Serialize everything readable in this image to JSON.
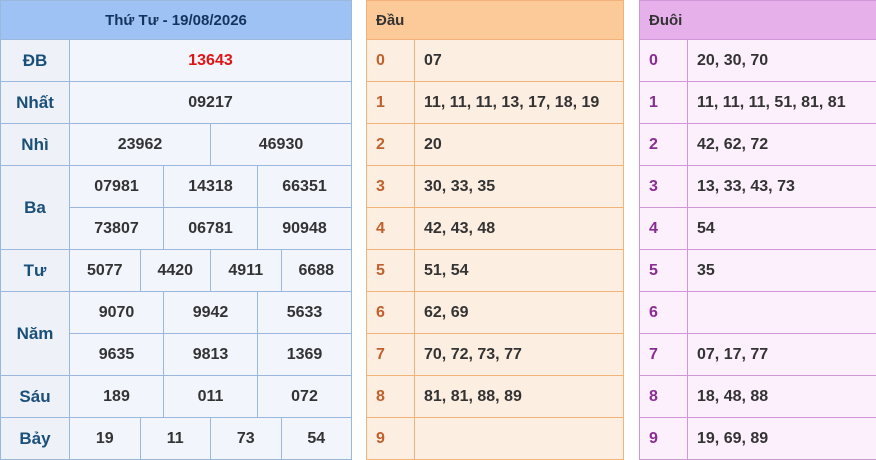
{
  "results": {
    "title": "Thứ Tư - 19/08/2026",
    "db": {
      "label": "ĐB",
      "value": "13643"
    },
    "nhat": {
      "label": "Nhất",
      "value": "09217"
    },
    "nhi": {
      "label": "Nhì",
      "values": [
        "23962",
        "46930"
      ]
    },
    "ba": {
      "label": "Ba",
      "values": [
        "07981",
        "14318",
        "66351",
        "73807",
        "06781",
        "90948"
      ]
    },
    "tu": {
      "label": "Tư",
      "values": [
        "5077",
        "4420",
        "4911",
        "6688"
      ]
    },
    "nam": {
      "label": "Năm",
      "values": [
        "9070",
        "9942",
        "5633",
        "9635",
        "9813",
        "1369"
      ]
    },
    "sau": {
      "label": "Sáu",
      "values": [
        "189",
        "011",
        "072"
      ]
    },
    "bay": {
      "label": "Bảy",
      "values": [
        "19",
        "11",
        "73",
        "54"
      ]
    }
  },
  "head": {
    "title": "Đầu",
    "rows": [
      {
        "k": "0",
        "v": "07"
      },
      {
        "k": "1",
        "v": "11, 11, 11, 13, 17, 18, 19"
      },
      {
        "k": "2",
        "v": "20"
      },
      {
        "k": "3",
        "v": "30, 33, 35"
      },
      {
        "k": "4",
        "v": "42, 43, 48"
      },
      {
        "k": "5",
        "v": "51, 54"
      },
      {
        "k": "6",
        "v": "62, 69"
      },
      {
        "k": "7",
        "v": "70, 72, 73, 77"
      },
      {
        "k": "8",
        "v": "81, 81, 88, 89"
      },
      {
        "k": "9",
        "v": ""
      }
    ]
  },
  "tail": {
    "title": "Đuôi",
    "rows": [
      {
        "k": "0",
        "v": "20, 30, 70"
      },
      {
        "k": "1",
        "v": "11, 11, 11, 51, 81, 81"
      },
      {
        "k": "2",
        "v": "42, 62, 72"
      },
      {
        "k": "3",
        "v": "13, 33, 43, 73"
      },
      {
        "k": "4",
        "v": "54"
      },
      {
        "k": "5",
        "v": "35"
      },
      {
        "k": "6",
        "v": ""
      },
      {
        "k": "7",
        "v": "07, 17, 77"
      },
      {
        "k": "8",
        "v": "18, 48, 88"
      },
      {
        "k": "9",
        "v": "19, 69, 89"
      }
    ]
  }
}
